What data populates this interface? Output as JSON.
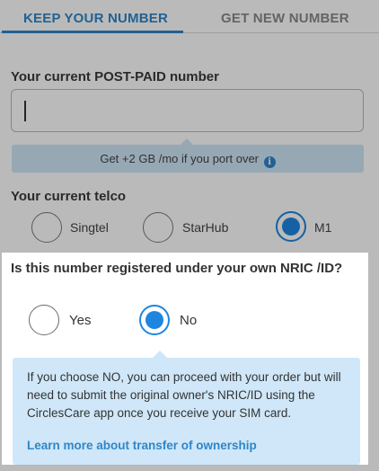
{
  "tabs": {
    "keep": "KEEP YOUR NUMBER",
    "new": "GET NEW NUMBER"
  },
  "number_field": {
    "label": "Your current POST-PAID number",
    "value": ""
  },
  "promo": {
    "text": "Get +2 GB /mo if you port over",
    "icon": "info-icon"
  },
  "telco": {
    "label": "Your current telco",
    "options": [
      "Singtel",
      "StarHub",
      "M1"
    ],
    "selected": "M1"
  },
  "ownership": {
    "question": "Is this number registered under your own NRIC /ID?",
    "options": [
      "Yes",
      "No"
    ],
    "selected": "No",
    "note": "If you choose NO, you can proceed with your order but will need to submit the original owner's NRIC/ID using the CirclesCare app once you receive your SIM card.",
    "link": "Learn more about transfer of ownership"
  },
  "colors": {
    "accent": "#2f86c9",
    "radio_selected": "#1f86e0",
    "info_bg": "#cfe7f8"
  }
}
